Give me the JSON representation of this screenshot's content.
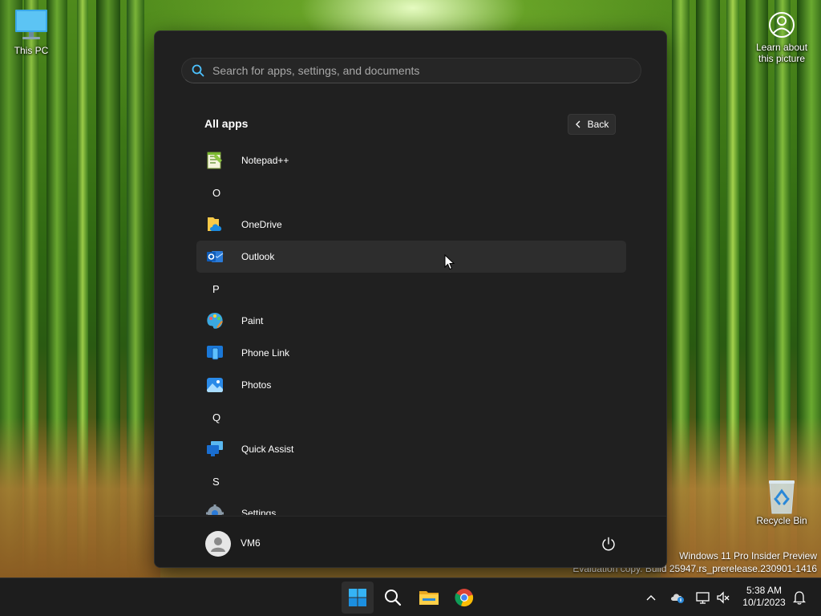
{
  "desktop": {
    "this_pc_label": "This PC",
    "learn_label_line1": "Learn about",
    "learn_label_line2": "this picture",
    "recycle_bin_label": "Recycle Bin",
    "watermark_line1": "Windows 11 Pro Insider Preview",
    "watermark_line2": "Evaluation copy. Build 25947.rs_prerelease.230901-1416"
  },
  "start_menu": {
    "search_placeholder": "Search for apps, settings, and documents",
    "title": "All apps",
    "back_label": "Back",
    "items": [
      {
        "type": "app",
        "label": "Notepad++",
        "icon": "notepad-plus-plus-icon"
      },
      {
        "type": "letter",
        "label": "O"
      },
      {
        "type": "app",
        "label": "OneDrive",
        "icon": "onedrive-icon"
      },
      {
        "type": "app",
        "label": "Outlook",
        "icon": "outlook-icon",
        "hover": true
      },
      {
        "type": "letter",
        "label": "P"
      },
      {
        "type": "app",
        "label": "Paint",
        "icon": "paint-icon"
      },
      {
        "type": "app",
        "label": "Phone Link",
        "icon": "phone-link-icon"
      },
      {
        "type": "app",
        "label": "Photos",
        "icon": "photos-icon"
      },
      {
        "type": "letter",
        "label": "Q"
      },
      {
        "type": "app",
        "label": "Quick Assist",
        "icon": "quick-assist-icon"
      },
      {
        "type": "letter",
        "label": "S"
      },
      {
        "type": "app",
        "label": "Settings",
        "icon": "settings-icon"
      }
    ],
    "user_name": "VM6"
  },
  "taskbar": {
    "pinned": [
      "start-icon",
      "search-icon",
      "file-explorer-icon",
      "chrome-icon"
    ],
    "clock_time": "5:38 AM",
    "clock_date": "10/1/2023"
  },
  "colors": {
    "menu_bg": "#202020",
    "hover_bg": "#2d2d2d",
    "taskbar_bg": "#1d1d1d",
    "accent": "#0078d4"
  }
}
